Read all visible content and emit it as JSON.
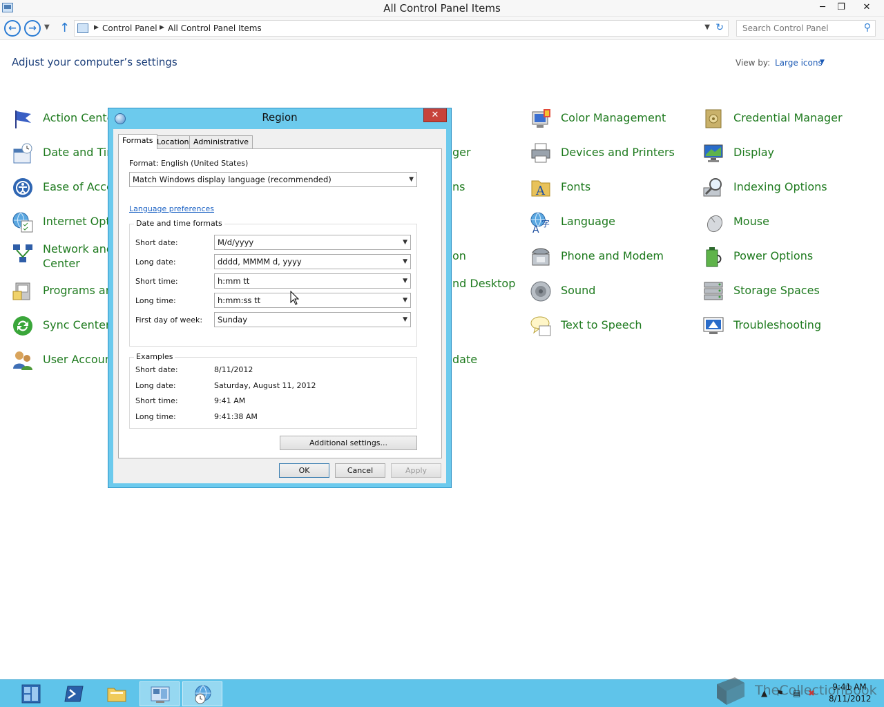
{
  "window": {
    "title": "All Control Panel Items"
  },
  "address": {
    "crumbs": [
      "Control Panel",
      "All Control Panel Items"
    ],
    "search_placeholder": "Search Control Panel"
  },
  "main": {
    "heading": "Adjust your computer’s settings",
    "view_by_label": "View by:",
    "view_by_value": "Large icons"
  },
  "items": {
    "action_center": "Action Center",
    "date_time": "Date and Time",
    "ease_access": "Ease of Access",
    "internet_options": "Internet Optio",
    "network_line1": "Network and",
    "network_line2": "Center",
    "programs": "Programs and",
    "sync_center": "Sync Center",
    "user_accounts": "User Accounts",
    "col2_r2": "ger",
    "col2_r3": "ns",
    "col2_r5": "on",
    "col2_r6": "nd Desktop",
    "col2_r8": "date",
    "color_management": "Color Management",
    "devices_printers": "Devices and Printers",
    "fonts": "Fonts",
    "language": "Language",
    "phone_modem": "Phone and Modem",
    "sound": "Sound",
    "text_to_speech": "Text to Speech",
    "credential_manager": "Credential Manager",
    "display": "Display",
    "indexing_options": "Indexing Options",
    "mouse": "Mouse",
    "power_options": "Power Options",
    "storage_spaces": "Storage Spaces",
    "troubleshooting": "Troubleshooting"
  },
  "dialog": {
    "title": "Region",
    "tabs": [
      "Formats",
      "Location",
      "Administrative"
    ],
    "format_label": "Format: English (United States)",
    "format_value": "Match Windows display language (recommended)",
    "language_link": "Language preferences",
    "dt_group_title": "Date and time formats",
    "short_date_label": "Short date:",
    "short_date_value": "M/d/yyyy",
    "long_date_label": "Long date:",
    "long_date_value": "dddd, MMMM d, yyyy",
    "short_time_label": "Short time:",
    "short_time_value": "h:mm tt",
    "long_time_label": "Long time:",
    "long_time_value": "h:mm:ss tt",
    "first_day_label": "First day of week:",
    "first_day_value": "Sunday",
    "examples_title": "Examples",
    "ex_short_date": "8/11/2012",
    "ex_long_date": "Saturday, August 11, 2012",
    "ex_short_time": "9:41 AM",
    "ex_long_time": "9:41:38 AM",
    "additional_settings": "Additional settings...",
    "ok": "OK",
    "cancel": "Cancel",
    "apply": "Apply"
  },
  "taskbar": {
    "clock_time": "9:41 AM",
    "clock_date": "8/11/2012",
    "watermark": "TheCollectionBook"
  }
}
